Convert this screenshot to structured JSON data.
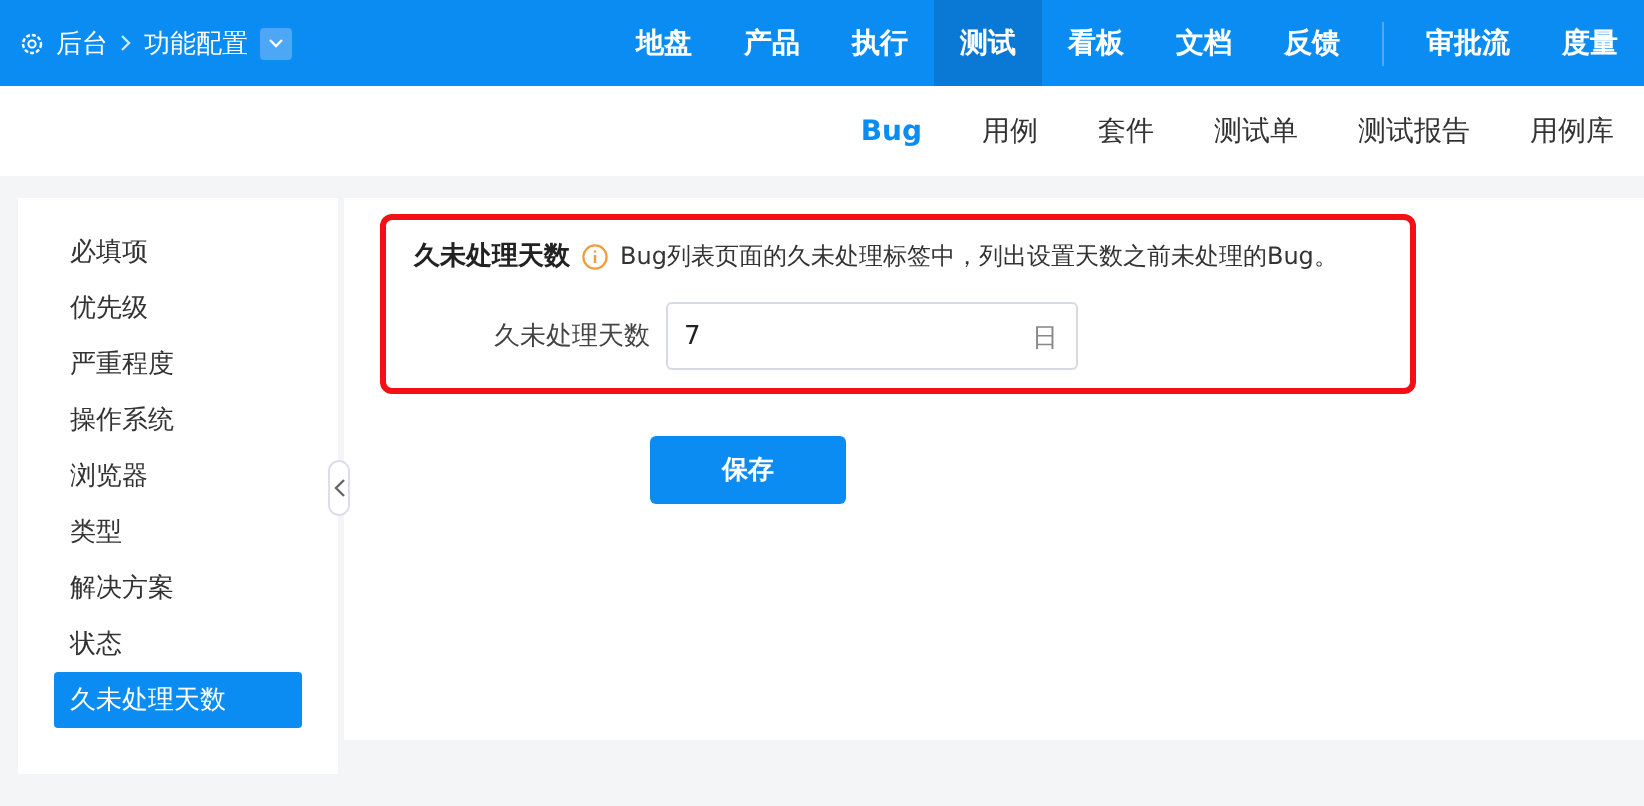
{
  "breadcrumb": {
    "home": "后台",
    "current": "功能配置"
  },
  "main_nav": [
    {
      "label": "地盘",
      "selected": false
    },
    {
      "label": "产品",
      "selected": false
    },
    {
      "label": "执行",
      "selected": false
    },
    {
      "label": "测试",
      "selected": true
    },
    {
      "label": "看板",
      "selected": false
    },
    {
      "label": "文档",
      "selected": false
    },
    {
      "label": "反馈",
      "selected": false
    }
  ],
  "extra_nav": [
    {
      "label": "审批流",
      "selected": false
    },
    {
      "label": "度量",
      "selected": false
    }
  ],
  "sub_nav": [
    {
      "label": "Bug",
      "selected": true
    },
    {
      "label": "用例",
      "selected": false
    },
    {
      "label": "套件",
      "selected": false
    },
    {
      "label": "测试单",
      "selected": false
    },
    {
      "label": "测试报告",
      "selected": false
    },
    {
      "label": "用例库",
      "selected": false
    }
  ],
  "sidebar": {
    "items": [
      {
        "label": "必填项",
        "selected": false
      },
      {
        "label": "优先级",
        "selected": false
      },
      {
        "label": "严重程度",
        "selected": false
      },
      {
        "label": "操作系统",
        "selected": false
      },
      {
        "label": "浏览器",
        "selected": false
      },
      {
        "label": "类型",
        "selected": false
      },
      {
        "label": "解决方案",
        "selected": false
      },
      {
        "label": "状态",
        "selected": false
      },
      {
        "label": "久未处理天数",
        "selected": true
      }
    ]
  },
  "form": {
    "title": "久未处理天数",
    "hint": "Bug列表页面的久未处理标签中，列出设置天数之前未处理的Bug。",
    "field_label": "久未处理天数",
    "value": "7",
    "unit": "日",
    "save": "保存"
  }
}
